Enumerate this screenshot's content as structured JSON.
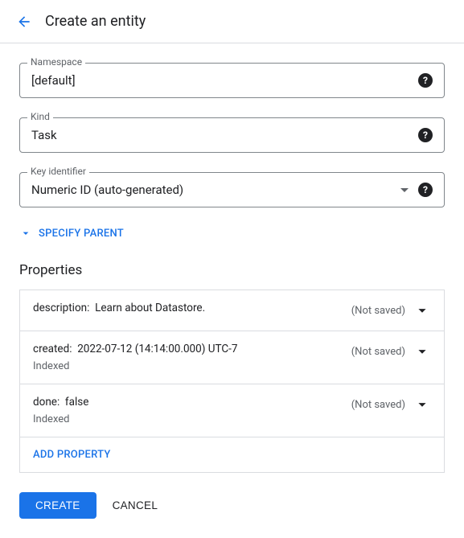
{
  "header": {
    "title": "Create an entity"
  },
  "fields": {
    "namespace": {
      "label": "Namespace",
      "value": "[default]"
    },
    "kind": {
      "label": "Kind",
      "value": "Task"
    },
    "keyIdentifier": {
      "label": "Key identifier",
      "value": "Numeric ID (auto-generated)"
    }
  },
  "specifyParent": "SPECIFY PARENT",
  "propertiesTitle": "Properties",
  "notSavedLabel": "(Not saved)",
  "indexedLabel": "Indexed",
  "properties": [
    {
      "name": "description",
      "value": "Learn about Datastore.",
      "indexed": false
    },
    {
      "name": "created",
      "value": "2022-07-12 (14:14:00.000) UTC-7",
      "indexed": true
    },
    {
      "name": "done",
      "value": "false",
      "indexed": true
    }
  ],
  "addPropertyLabel": "ADD PROPERTY",
  "buttons": {
    "create": "CREATE",
    "cancel": "CANCEL"
  }
}
